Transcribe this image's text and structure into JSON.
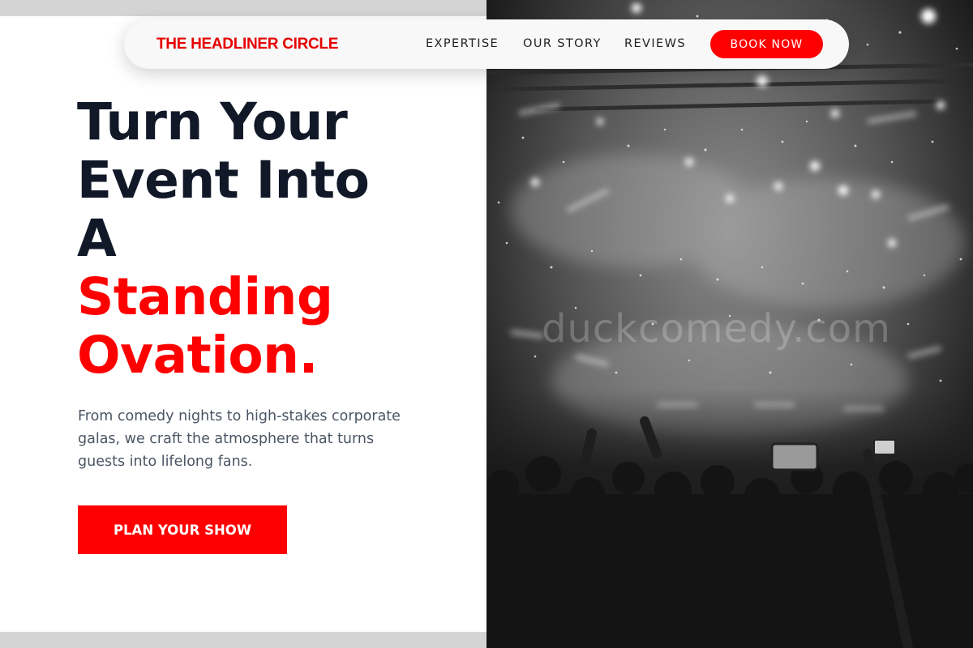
{
  "nav": {
    "brand": "THE HEADLINER CIRCLE",
    "links": [
      "EXPERTISE",
      "OUR STORY",
      "REVIEWS"
    ],
    "cta_label": "BOOK NOW"
  },
  "hero": {
    "headline_lines": [
      "Turn Your",
      "Event Into",
      "A"
    ],
    "headline_accent_lines": [
      "Standing",
      "Ovation."
    ],
    "subtext": "From comedy nights to high-stakes corporate galas, we craft the atmosphere that turns guests into lifelong fans.",
    "cta_label": "PLAN YOUR SHOW"
  },
  "image": {
    "description": "black-and-white concert crowd with confetti and stage lights",
    "watermark": "duckcomedy.com"
  },
  "colors": {
    "accent": "#ff0000",
    "heading": "#111827",
    "body_text": "#4b5563",
    "page_bg": "#d4d4d4"
  }
}
